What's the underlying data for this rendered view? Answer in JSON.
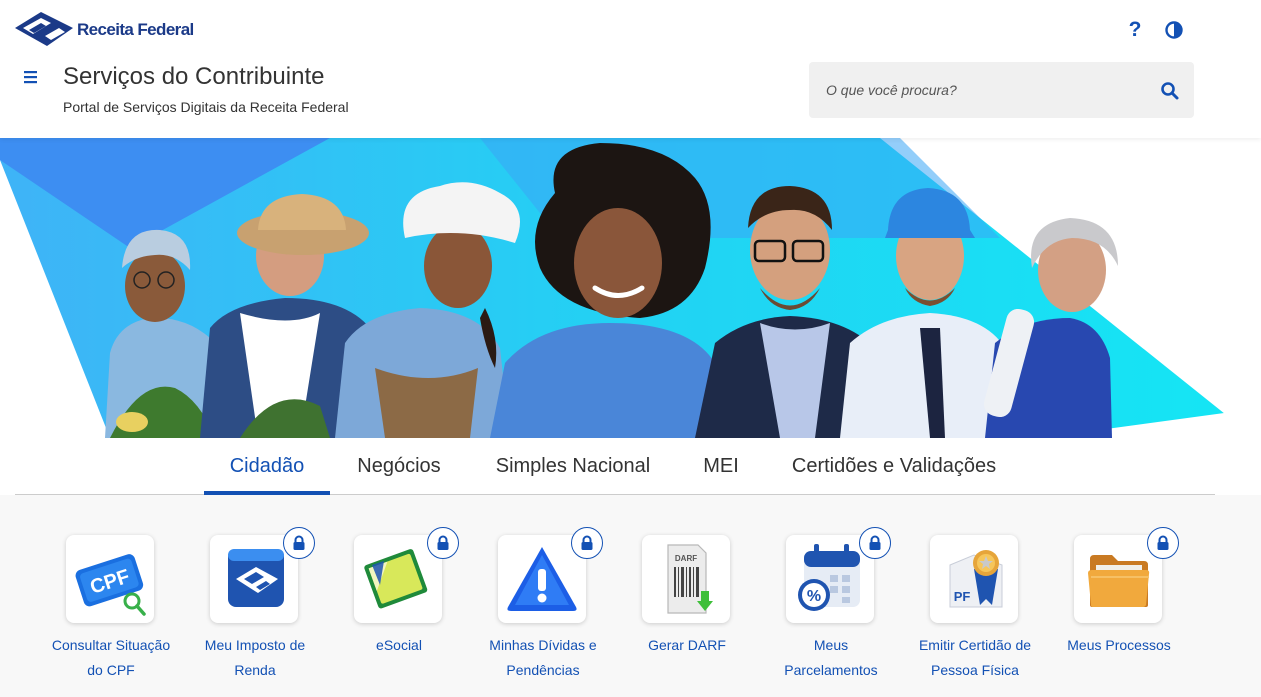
{
  "header": {
    "logo_text": "Receita Federal",
    "help_label": "?",
    "title": "Serviços do Contribuinte",
    "subtitle": "Portal de Serviços Digitais da Receita Federal",
    "search_placeholder": "O que você procura?",
    "icons": [
      "receita-federal-logo-icon",
      "help-icon",
      "contrast-icon",
      "menu-icon",
      "search-icon"
    ]
  },
  "tabs": [
    {
      "label": "Cidadão",
      "active": true
    },
    {
      "label": "Negócios",
      "active": false
    },
    {
      "label": "Simples Nacional",
      "active": false
    },
    {
      "label": "MEI",
      "active": false
    },
    {
      "label": "Certidões e Validações",
      "active": false
    }
  ],
  "services": [
    {
      "line1": "Consultar Situação",
      "line2": "do CPF",
      "icon": "cpf-icon",
      "locked": false
    },
    {
      "line1": "Meu Imposto de",
      "line2": "Renda",
      "icon": "imposto-renda-icon",
      "locked": true
    },
    {
      "line1": "eSocial",
      "line2": "",
      "icon": "esocial-icon",
      "locked": true
    },
    {
      "line1": "Minhas Dívidas e",
      "line2": "Pendências",
      "icon": "warning-icon",
      "locked": true
    },
    {
      "line1": "Gerar DARF",
      "line2": "",
      "icon": "darf-download-icon",
      "locked": false
    },
    {
      "line1": "Meus",
      "line2": "Parcelamentos",
      "icon": "calendar-percent-icon",
      "locked": true
    },
    {
      "line1": "Emitir Certidão de",
      "line2": "Pessoa Física",
      "icon": "certificate-pf-icon",
      "locked": false
    },
    {
      "line1": "Meus Processos",
      "line2": "",
      "icon": "folder-icon",
      "locked": true
    }
  ],
  "colors": {
    "primary": "#1351b4",
    "logo": "#1b3a88",
    "text": "#333333",
    "banner_cyan": "#29d3f3",
    "banner_blue": "#3d8ef2",
    "services_bg": "#f8f8f8"
  }
}
